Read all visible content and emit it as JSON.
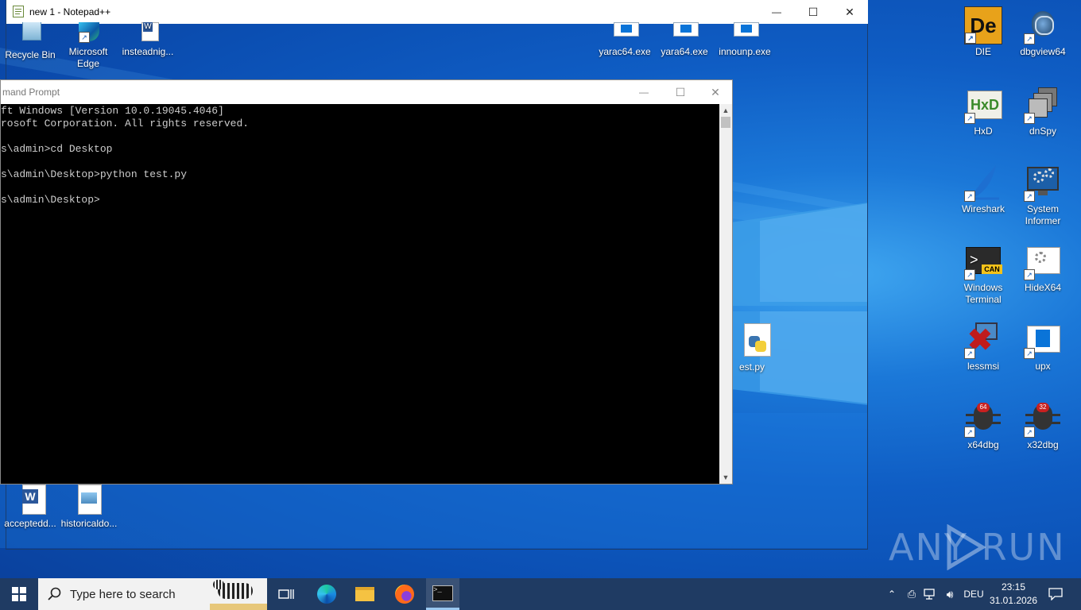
{
  "notepad": {
    "title": "new 1 - Notepad++",
    "minimize": "—",
    "maximize": "☐",
    "close": "✕"
  },
  "cmd": {
    "title": "mand Prompt",
    "lines": [
      "ft Windows [Version 10.0.19045.4046]",
      "rosoft Corporation. All rights reserved.",
      "",
      "s\\admin>cd Desktop",
      "",
      "s\\admin\\Desktop>python test.py",
      "",
      "s\\admin\\Desktop>"
    ]
  },
  "desktop_icons": {
    "recycle_bin": "Recycle Bin",
    "edge": "Microsoft Edge",
    "insteadnig": "insteadnig...",
    "yarac64": "yarac64.exe",
    "yara64": "yara64.exe",
    "innounp": "innounp.exe",
    "die": "DIE",
    "dbgview64": "dbgview64",
    "hxd": "HxD",
    "dnspy": "dnSpy",
    "wireshark": "Wireshark",
    "system_informer": "System Informer",
    "windows_terminal": "Windows Terminal",
    "hidex64": "HideX64",
    "lessmsi": "lessmsi",
    "upx": "upx",
    "x64dbg": "x64dbg",
    "x32dbg": "x32dbg",
    "testpy": "est.py",
    "acceptedd": "acceptedd...",
    "historicaldo": "historicaldo..."
  },
  "watermark": "ANY RUN",
  "taskbar": {
    "search_placeholder": "Type here to search",
    "tray_lang": "DEU",
    "time": "23:15",
    "date": "31.01.2026"
  },
  "colors": {
    "accent": "#0a58c4",
    "taskbar": "#1f3b63",
    "cmd_bg": "#000000"
  }
}
